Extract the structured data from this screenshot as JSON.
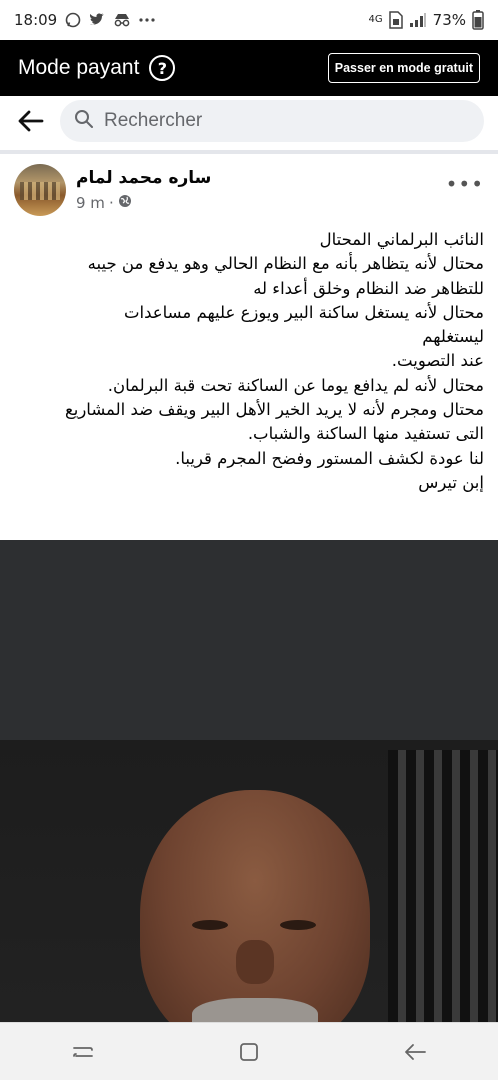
{
  "status_bar": {
    "time": "18:09",
    "left_icons": [
      "whatsapp-icon",
      "twitter-icon",
      "incognito-icon",
      "more-dots-icon"
    ],
    "battery": "73%",
    "network": "4G"
  },
  "mode_bar": {
    "title": "Mode payant",
    "help_symbol": "?",
    "free_mode_label": "Passer en mode gratuit"
  },
  "search": {
    "placeholder": "Rechercher"
  },
  "post": {
    "author": "ساره محمد لمام",
    "time": "9 m",
    "more": "•••",
    "lines": [
      "النائب البرلماني المحتال",
      "محتال لأنه يتظاهر بأنه مع النظام الحالي  وهو يدفع من جيبه",
      "للتظاهر ضد النظام وخلق أعداء له",
      "محتال لأنه يستغل ساكنة البير ويوزع عليهم مساعدات",
      "ليستغلهم",
      "عند التصويت.",
      "محتال لأنه لم يدافع يوما عن الساكنة تحت قبة البرلمان.",
      "محتال ومجرم لأنه لا يريد الخير الأهل البير ويقف ضد المشاريع",
      "التى تستفيد منها الساكنة والشباب.",
      "لنا عودة لكشف المستور وفضح المجرم قريبا.",
      "إبن تيرس"
    ]
  },
  "colors": {
    "mode_bar_bg": "#000000",
    "search_bg": "#eff1f4",
    "text": "#050505",
    "meta_text": "#65676b"
  }
}
